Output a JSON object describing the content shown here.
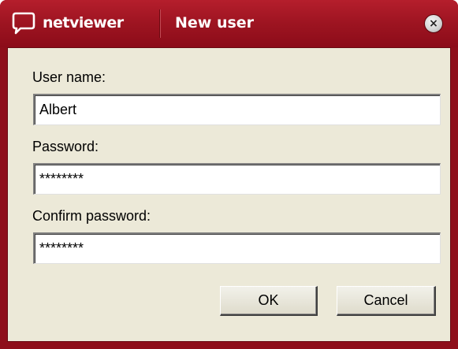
{
  "titlebar": {
    "logo_text": "netviewer",
    "title": "New user",
    "close_symbol": "×"
  },
  "form": {
    "username_label": "User name:",
    "username_value": "Albert",
    "password_label": "Password:",
    "password_value": "********",
    "confirm_label": "Confirm password:",
    "confirm_value": "********"
  },
  "buttons": {
    "ok_label": "OK",
    "cancel_label": "Cancel"
  },
  "icons": {
    "logo": "speech-bubble-icon",
    "close": "close-icon"
  },
  "colors": {
    "titlebar": "#9d1421",
    "frame": "#8e0e1a",
    "client": "#ece9d8"
  }
}
